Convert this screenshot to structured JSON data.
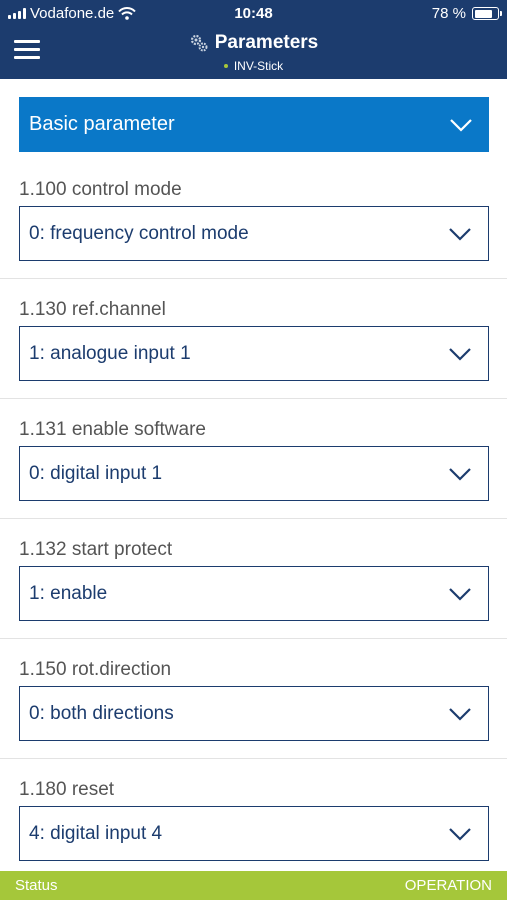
{
  "status_bar": {
    "carrier": "Vodafone.de",
    "time": "10:48",
    "battery": "78 %",
    "battery_level": 0.78
  },
  "header": {
    "title": "Parameters",
    "subtitle": "INV-Stick"
  },
  "group": {
    "selected": "Basic parameter"
  },
  "parameters": [
    {
      "label": "1.100 control mode",
      "value": "0: frequency control mode"
    },
    {
      "label": "1.130 ref.channel",
      "value": "1: analogue input 1"
    },
    {
      "label": "1.131 enable software",
      "value": "0: digital input 1"
    },
    {
      "label": "1.132 start protect",
      "value": "1: enable"
    },
    {
      "label": "1.150 rot.direction",
      "value": "0: both directions"
    },
    {
      "label": "1.180 reset",
      "value": "4: digital input 4"
    }
  ],
  "footer": {
    "left": "Status",
    "right": "OPERATION"
  },
  "colors": {
    "header_bg": "#1c3c6e",
    "accent_blue": "#0a78c8",
    "footer_green": "#a5c73a"
  }
}
